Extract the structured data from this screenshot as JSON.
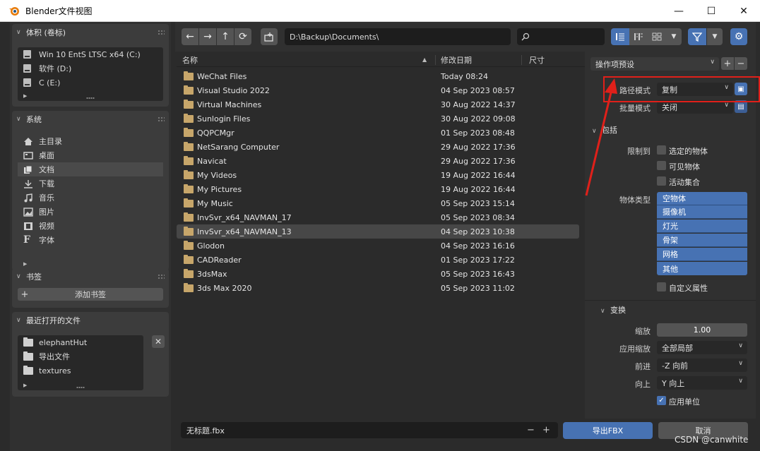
{
  "window": {
    "title": "Blender文件视图",
    "min": "—",
    "max": "☐",
    "close": "✕"
  },
  "sidebar": {
    "volumes": {
      "header": "体积 (卷标)",
      "items": [
        {
          "label": "Win 10 EntS LTSC x64 (C:)"
        },
        {
          "label": "软件 (D:)"
        },
        {
          "label": "C (E:)"
        }
      ]
    },
    "system": {
      "header": "系统",
      "items": [
        {
          "label": "主目录",
          "icon": "home-icon"
        },
        {
          "label": "桌面",
          "icon": "desktop-icon"
        },
        {
          "label": "文档",
          "icon": "documents-icon",
          "selected": true
        },
        {
          "label": "下载",
          "icon": "download-icon"
        },
        {
          "label": "音乐",
          "icon": "music-icon"
        },
        {
          "label": "图片",
          "icon": "image-icon"
        },
        {
          "label": "视频",
          "icon": "video-icon"
        },
        {
          "label": "字体",
          "icon": "font-icon"
        }
      ]
    },
    "bookmarks": {
      "header": "书签",
      "add_label": "添加书签"
    },
    "recent": {
      "header": "最近打开的文件",
      "items": [
        {
          "label": "elephantHut"
        },
        {
          "label": "导出文件"
        },
        {
          "label": "textures"
        }
      ]
    }
  },
  "toolbar": {
    "path": "D:\\Backup\\Documents\\"
  },
  "columns": {
    "name": "名称",
    "date": "修改日期",
    "size": "尺寸"
  },
  "files": [
    {
      "name": "WeChat Files",
      "date": "Today 08:24"
    },
    {
      "name": "Visual Studio 2022",
      "date": "04 Sep 2023 08:57"
    },
    {
      "name": "Virtual Machines",
      "date": "30 Aug 2022 14:37"
    },
    {
      "name": "Sunlogin Files",
      "date": "30 Aug 2022 09:08"
    },
    {
      "name": "QQPCMgr",
      "date": "01 Sep 2023 08:48"
    },
    {
      "name": "NetSarang Computer",
      "date": "29 Aug 2022 17:36"
    },
    {
      "name": "Navicat",
      "date": "29 Aug 2022 17:36"
    },
    {
      "name": "My Videos",
      "date": "19 Aug 2022 16:44"
    },
    {
      "name": "My Pictures",
      "date": "19 Aug 2022 16:44"
    },
    {
      "name": "My Music",
      "date": "05 Sep 2023 15:14"
    },
    {
      "name": "InvSvr_x64_NAVMAN_17",
      "date": "05 Sep 2023 08:34"
    },
    {
      "name": "InvSvr_x64_NAVMAN_13",
      "date": "04 Sep 2023 10:38",
      "selected": true
    },
    {
      "name": "Glodon",
      "date": "04 Sep 2023 16:16"
    },
    {
      "name": "CADReader",
      "date": "01 Sep 2023 17:22"
    },
    {
      "name": "3dsMax",
      "date": "05 Sep 2023 16:43"
    },
    {
      "name": "3ds Max 2020",
      "date": "05 Sep 2023 11:02"
    }
  ],
  "props": {
    "preset": "操作项预设",
    "path_mode_label": "路径模式",
    "path_mode_value": "复制",
    "batch_mode_label": "批量模式",
    "batch_mode_value": "关闭",
    "include_header": "包括",
    "limit_label": "限制到",
    "limit_opts": [
      "选定的物体",
      "可见物体",
      "活动集合"
    ],
    "object_type_label": "物体类型",
    "object_types": [
      "空物体",
      "摄像机",
      "灯光",
      "骨架",
      "网格",
      "其他"
    ],
    "custom_props": "自定义属性",
    "transform_header": "变换",
    "scale_label": "缩放",
    "scale_value": "1.00",
    "apply_scale_label": "应用缩放",
    "apply_scale_value": "全部局部",
    "forward_label": "前进",
    "forward_value": "-Z 向前",
    "up_label": "向上",
    "up_value": "Y 向上",
    "apply_unit": "应用单位"
  },
  "bottom": {
    "filename": "无标题.fbx",
    "export": "导出FBX",
    "cancel": "取消"
  },
  "watermark": "CSDN @canwhite",
  "colors": {
    "accent": "#4772b3",
    "folder": "#c7a66a",
    "annotation": "#e0201a"
  }
}
